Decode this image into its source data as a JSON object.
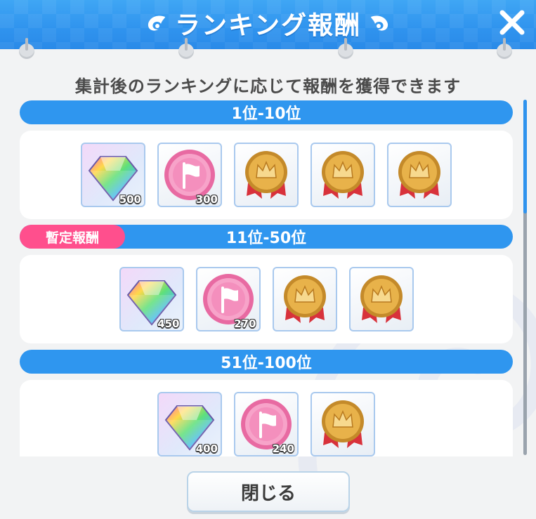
{
  "header": {
    "title": "ランキング報酬"
  },
  "subtitle": "集計後のランキングに応じて報酬を獲得できます",
  "tiers": [
    {
      "label": "1位-10位",
      "tag": "",
      "rewards": [
        {
          "type": "jewel",
          "icon": "rainbow-gem-icon",
          "qty": "500"
        },
        {
          "type": "coin",
          "icon": "pink-coin-icon",
          "qty": "300"
        },
        {
          "type": "medal",
          "icon": "gold-medal-icon",
          "qty": ""
        },
        {
          "type": "medal",
          "icon": "gold-medal-icon",
          "qty": ""
        },
        {
          "type": "medal",
          "icon": "gold-medal-icon",
          "qty": ""
        }
      ]
    },
    {
      "label": "11位-50位",
      "tag": "暫定報酬",
      "rewards": [
        {
          "type": "jewel",
          "icon": "rainbow-gem-icon",
          "qty": "450"
        },
        {
          "type": "coin",
          "icon": "pink-coin-icon",
          "qty": "270"
        },
        {
          "type": "medal",
          "icon": "gold-medal-icon",
          "qty": ""
        },
        {
          "type": "medal",
          "icon": "gold-medal-icon",
          "qty": ""
        }
      ]
    },
    {
      "label": "51位-100位",
      "tag": "",
      "rewards": [
        {
          "type": "jewel",
          "icon": "rainbow-gem-icon",
          "qty": "400"
        },
        {
          "type": "coin",
          "icon": "pink-coin-icon",
          "qty": "240"
        },
        {
          "type": "medal",
          "icon": "gold-medal-icon",
          "qty": ""
        }
      ]
    }
  ],
  "footer": {
    "close_label": "閉じる"
  },
  "colors": {
    "header": "#2f93ee",
    "band": "#2f96ef",
    "tag": "#ff4f8d",
    "background": "#f2f3f4"
  }
}
